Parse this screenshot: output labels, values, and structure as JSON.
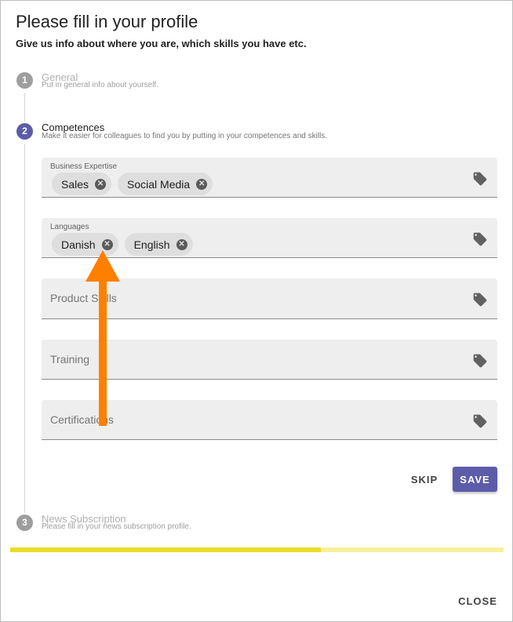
{
  "dialog": {
    "title": "Please fill in your profile",
    "subtitle": "Give us info about where you are, which skills you have etc."
  },
  "steps": [
    {
      "number": "1",
      "title": "General",
      "description": "Put in general info about yourself.",
      "state": "inactive"
    },
    {
      "number": "2",
      "title": "Competences",
      "description": "Make it easier for colleagues to find you by putting in your competences and skills.",
      "state": "active"
    },
    {
      "number": "3",
      "title": "News Subscription",
      "description": "Please fill in your news subscription profile.",
      "state": "inactive"
    }
  ],
  "fields": {
    "business_expertise": {
      "label": "Business Expertise",
      "chips": [
        "Sales",
        "Social Media"
      ],
      "icon": "tag-icon"
    },
    "languages": {
      "label": "Languages",
      "chips": [
        "Danish",
        "English"
      ],
      "icon": "tag-icon"
    },
    "product_skills": {
      "placeholder": "Product Skills",
      "icon": "tag-icon"
    },
    "training": {
      "placeholder": "Training",
      "icon": "tag-icon"
    },
    "certifications": {
      "placeholder": "Certifications",
      "icon": "tag-icon"
    }
  },
  "actions": {
    "skip_label": "SKIP",
    "save_label": "SAVE",
    "close_label": "CLOSE"
  },
  "progress": {
    "value": 0.63
  },
  "colors": {
    "accent": "#5c5caa",
    "progress_fill": "#eadc2a",
    "progress_track": "#f9ef9b",
    "annotation_arrow": "#ff7f00"
  }
}
